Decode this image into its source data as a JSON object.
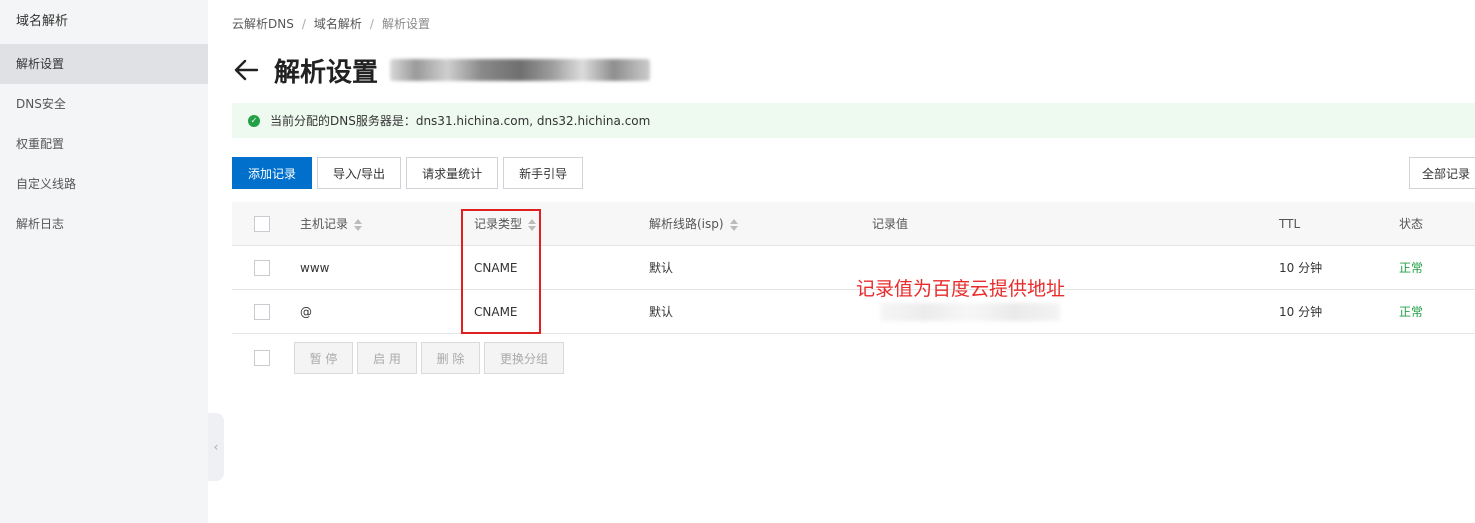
{
  "sidebar": {
    "title": "域名解析",
    "items": [
      {
        "label": "解析设置",
        "active": true
      },
      {
        "label": "DNS安全",
        "active": false
      },
      {
        "label": "权重配置",
        "active": false
      },
      {
        "label": "自定义线路",
        "active": false
      },
      {
        "label": "解析日志",
        "active": false
      }
    ]
  },
  "breadcrumb": [
    "云解析DNS",
    "域名解析",
    "解析设置"
  ],
  "page": {
    "title": "解析设置"
  },
  "notice": {
    "text": "当前分配的DNS服务器是：dns31.hichina.com, dns32.hichina.com"
  },
  "toolbar": {
    "add_record": "添加记录",
    "import_export": "导入/导出",
    "request_stats": "请求量统计",
    "guide": "新手引导",
    "all_records": "全部记录"
  },
  "table": {
    "columns": {
      "host": "主机记录",
      "type": "记录类型",
      "line": "解析线路(isp)",
      "value": "记录值",
      "ttl": "TTL",
      "status": "状态"
    },
    "rows": [
      {
        "host": "www",
        "type": "CNAME",
        "line": "默认",
        "ttl": "10 分钟",
        "status": "正常"
      },
      {
        "host": "@",
        "type": "CNAME",
        "line": "默认",
        "ttl": "10 分钟",
        "status": "正常"
      }
    ]
  },
  "batch": {
    "pause": "暂 停",
    "enable": "启 用",
    "delete": "删 除",
    "change_group": "更换分组"
  },
  "annotation": {
    "text": "记录值为百度云提供地址",
    "color": "#e82c2c"
  },
  "colors": {
    "primary": "#0070cc",
    "success": "#22a045",
    "notice_bg": "#eefaf0"
  }
}
